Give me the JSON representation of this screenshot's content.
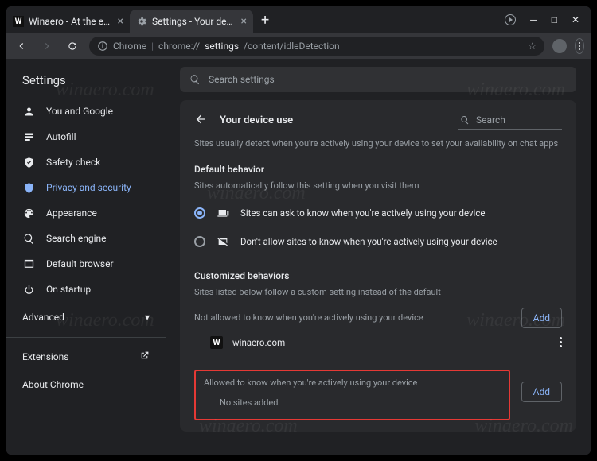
{
  "tabs": {
    "t0": {
      "title": "Winaero - At the edge of tweaki"
    },
    "t1": {
      "title": "Settings - Your device use"
    }
  },
  "omnibox": {
    "scheme_label": "Chrome",
    "path_prefix": "chrome://",
    "path_mid": "settings",
    "path_suffix": "/content/idleDetection"
  },
  "settings_title": "Settings",
  "search_placeholder": "Search settings",
  "sidebar": {
    "items": [
      {
        "label": "You and Google"
      },
      {
        "label": "Autofill"
      },
      {
        "label": "Safety check"
      },
      {
        "label": "Privacy and security"
      },
      {
        "label": "Appearance"
      },
      {
        "label": "Search engine"
      },
      {
        "label": "Default browser"
      },
      {
        "label": "On startup"
      }
    ],
    "advanced": "Advanced",
    "extensions": "Extensions",
    "about": "About Chrome"
  },
  "page": {
    "title": "Your device use",
    "search": "Search",
    "intro": "Sites usually detect when you're actively using your device to set your availability on chat apps",
    "default_h": "Default behavior",
    "default_sub": "Sites automatically follow this setting when you visit them",
    "opt_allow": "Sites can ask to know when you're actively using your device",
    "opt_block": "Don't allow sites to know when you're actively using your device",
    "custom_h": "Customized behaviors",
    "custom_sub": "Sites listed below follow a custom setting instead of the default",
    "not_allowed_label": "Not allowed to know when you're actively using your device",
    "allowed_label": "Allowed to know when you're actively using your device",
    "add": "Add",
    "site0": "winaero.com",
    "no_sites": "No sites added"
  },
  "watermark": "winaero.com"
}
